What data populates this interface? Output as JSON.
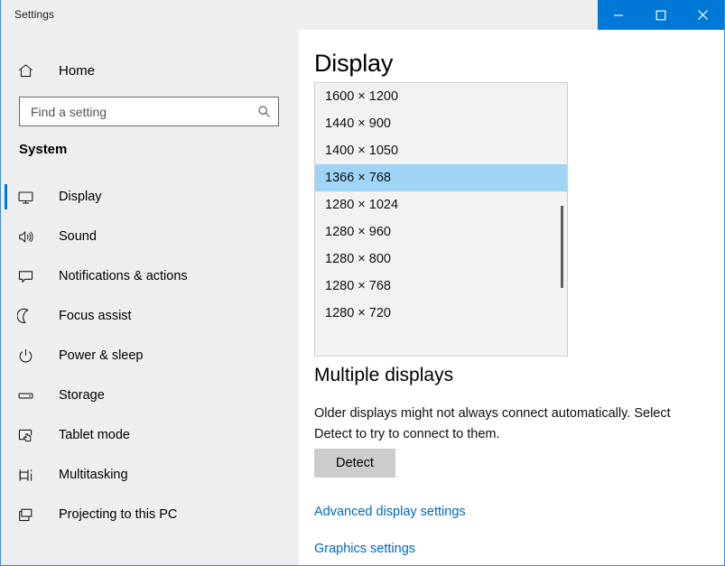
{
  "window": {
    "title": "Settings",
    "caption_buttons": [
      {
        "name": "minimize",
        "glyph": "minimize-icon",
        "label": "Minimize"
      },
      {
        "name": "maximize",
        "glyph": "maximize-icon",
        "label": "Maximize"
      },
      {
        "name": "close",
        "glyph": "close-icon",
        "label": "Close"
      }
    ],
    "accent_color": "#0078d7",
    "border_color": "#3d8ad8"
  },
  "sidebar": {
    "home_label": "Home",
    "home_icon": "home-icon",
    "search": {
      "placeholder": "Find a setting",
      "value": "",
      "icon": "search-icon"
    },
    "group_heading": "System",
    "items": [
      {
        "label": "Display",
        "icon": "monitor-icon",
        "selected": true
      },
      {
        "label": "Sound",
        "icon": "speaker-icon",
        "selected": false
      },
      {
        "label": "Notifications & actions",
        "icon": "speech-bubble-icon",
        "selected": false
      },
      {
        "label": "Focus assist",
        "icon": "moon-icon",
        "selected": false
      },
      {
        "label": "Power & sleep",
        "icon": "power-icon",
        "selected": false
      },
      {
        "label": "Storage",
        "icon": "drive-icon",
        "selected": false
      },
      {
        "label": "Tablet mode",
        "icon": "tablet-hand-icon",
        "selected": false
      },
      {
        "label": "Multitasking",
        "icon": "multitasking-icon",
        "selected": false
      },
      {
        "label": "Projecting to this PC",
        "icon": "projector-icon",
        "selected": false
      }
    ]
  },
  "main": {
    "page_title": "Display",
    "resolution_list": {
      "selected_value": "1366 × 768",
      "options": [
        "1600 × 1200",
        "1440 × 900",
        "1400 × 1050",
        "1366 × 768",
        "1280 × 1024",
        "1280 × 960",
        "1280 × 800",
        "1280 × 768",
        "1280 × 720"
      ],
      "highlight_color": "#9fd4f7"
    },
    "multiple_displays": {
      "heading": "Multiple displays",
      "description": "Older displays might not always connect automatically. Select Detect to try to connect to them.",
      "detect_label": "Detect"
    },
    "links": [
      {
        "label": "Advanced display settings"
      },
      {
        "label": "Graphics settings"
      }
    ],
    "link_color": "#0067c0"
  }
}
